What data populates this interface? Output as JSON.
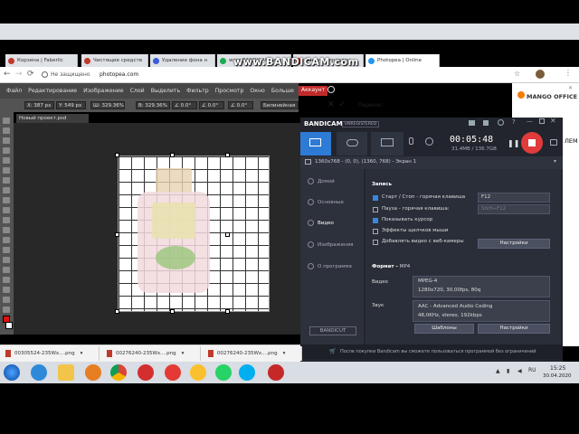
{
  "browser": {
    "tabs": [
      {
        "label": "Корзина | Faberlic",
        "color": "#c0392b"
      },
      {
        "label": "Чистящие средств",
        "color": "#c0392b"
      },
      {
        "label": "Удаление фона н",
        "color": "#3b5bdb"
      },
      {
        "label": "www.BANDICAM.com",
        "color": "#1aaa55"
      },
      {
        "label": "Панель управлен",
        "color": "#e53935"
      },
      {
        "label": "Photopea | Online",
        "color": "#2196f3"
      }
    ],
    "security": "Не защищено",
    "url": "photopea.com",
    "watermark": "www.BANDICAM.com"
  },
  "photopea": {
    "menu": [
      "Файл",
      "Редактирование",
      "Изображение",
      "Слой",
      "Выделить",
      "Фильтр",
      "Просмотр",
      "Окно",
      "Больше"
    ],
    "account": "Аккаунт",
    "options": {
      "x": "X: 387 px",
      "y": "Y: 549 px",
      "w": "Ш: 329.36%",
      "h": "В: 329.36%",
      "a": "∠ 0.0°",
      "hx": "∠ 0.0°",
      "vy": "∠ 0.0°",
      "interp": "Билинейная",
      "warp": "Перекос:"
    },
    "doc_tab": "Новый проект.psd"
  },
  "ad": {
    "brand": "MANGO OFFICE",
    "snippet": "ЛЕМ",
    "close": "✕"
  },
  "bandicam": {
    "logo": "BANDICAM",
    "badge": "UNREGISTERED",
    "timer": "00:05:48",
    "size": "31.4MB / 136.7GB",
    "region": "1360x768 - (0, 0), (1360, 768) - Экран 1",
    "sidebar": [
      "Домой",
      "Основные",
      "Видео",
      "Изображения",
      "О программе"
    ],
    "section_record": "Запись",
    "options": [
      {
        "label": "Старт / Стоп - горячая клавиша",
        "checked": true,
        "value": "F12"
      },
      {
        "label": "Пауза - горячая клавиша:",
        "checked": false,
        "value": "Shift+F12"
      },
      {
        "label": "Показывать курсор",
        "checked": true
      },
      {
        "label": "Эффекты щелчков мыши",
        "checked": false
      },
      {
        "label": "Добавлять видео с веб-камеры",
        "checked": false
      }
    ],
    "settings1": "Настройки",
    "format_label": "Формат",
    "format_value": "MP4",
    "video_label": "Видео",
    "video_codec": "MPEG-4",
    "video_params": "1280x720, 30,00fps, 80q",
    "audio_label": "Звук",
    "audio_codec": "AAC - Advanced Audio Coding",
    "audio_params": "48,0KHz, stereo, 192kbps",
    "templates": "Шаблоны",
    "settings2": "Настройки",
    "bandicut": "BANDICUT",
    "footer": "После покупки Bandicam вы сможете пользоваться программой без ограничений"
  },
  "downloads": [
    "00305524-235Wx....png",
    "00276240-235Wx....png",
    "00276240-235Wx....png"
  ],
  "taskbar": {
    "time": "15:25",
    "date": "30.04.2020"
  }
}
